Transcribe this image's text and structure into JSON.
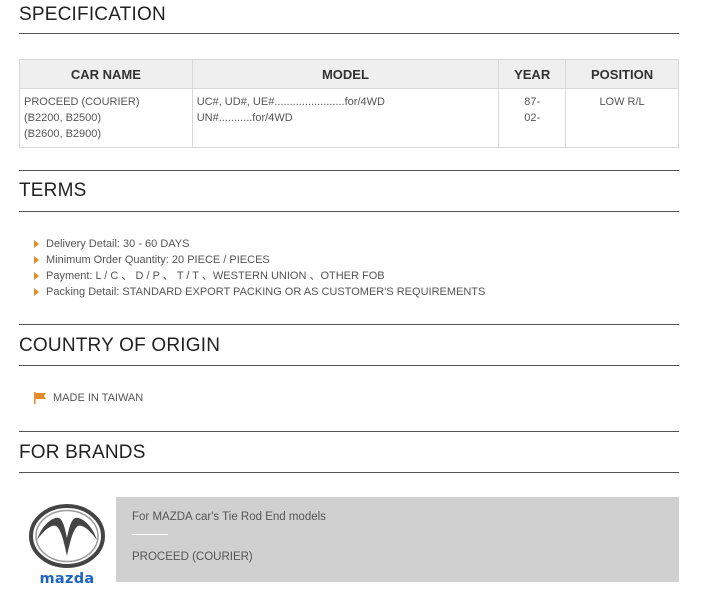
{
  "specification": {
    "title": "SPECIFICATION",
    "headers": [
      "CAR NAME",
      "MODEL",
      "YEAR",
      "POSITION"
    ],
    "row": {
      "car_name": [
        "PROCEED (COURIER)",
        "(B2200, B2500)",
        "(B2600, B2900)"
      ],
      "model": [
        "UC#, UD#, UE#.......................for/4WD",
        "UN#...........for/4WD"
      ],
      "year": [
        "87-",
        "02-"
      ],
      "position": "LOW R/L"
    }
  },
  "terms": {
    "title": "TERMS",
    "items": [
      "Delivery Detail: 30 - 60 DAYS",
      "Minimum Order Quantity: 20 PIECE / PIECES",
      "Payment: L / C 、 D / P 、 T / T 、WESTERN UNION 、OTHER FOB",
      "Packing Detail: STANDARD EXPORT PACKING OR AS CUSTOMER'S REQUIREMENTS"
    ]
  },
  "origin": {
    "title": "COUNTRY OF ORIGIN",
    "value": "MADE IN TAIWAN"
  },
  "brands": {
    "title": "FOR BRANDS",
    "logo_text": "mazda",
    "description": "For MAZDA car's Tie Rod End models",
    "model": "PROCEED (COURIER)"
  },
  "colors": {
    "accent": "#e58a2b",
    "header_bg": "#efefef",
    "brand_box_bg": "#d0d0d0",
    "mazda_blue": "#1d63c5"
  },
  "icons": {
    "bullet": "orange-arrow-icon",
    "origin": "flag-icon"
  }
}
